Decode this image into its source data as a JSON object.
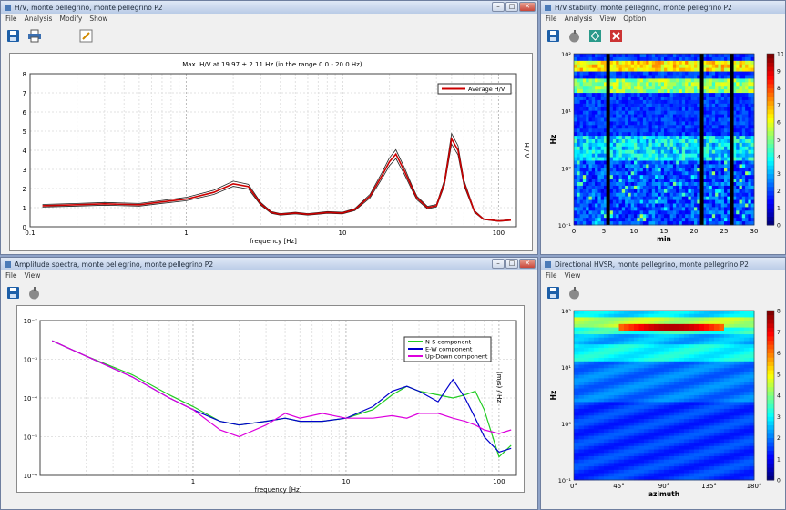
{
  "colors": {
    "red": "#cc0000",
    "green": "#22cc22",
    "blue": "#0000cc",
    "magenta": "#dd00dd",
    "titlebar": "#c9d7ee"
  },
  "hv_window": {
    "title": "H/V, monte pellegrino, monte pellegrino P2",
    "menu": [
      "File",
      "Analysis",
      "Modify",
      "Show"
    ],
    "toolbar_icons": [
      "save-icon",
      "print-icon",
      "edit-icon"
    ],
    "chart_data": {
      "type": "line",
      "title": "Max. H/V at 19.97 ± 2.11 Hz (in the range 0.0 - 20.0 Hz).",
      "xlabel": "frequency [Hz]",
      "ylabel": "H / V",
      "x_scale": "log",
      "xlim": [
        0.1,
        130
      ],
      "ylim": [
        0,
        8
      ],
      "y_ticks": [
        "0",
        "1",
        "2",
        "3",
        "4",
        "5",
        "6",
        "7",
        "8"
      ],
      "x_ticks": [
        "0.1",
        "1",
        "10",
        "100"
      ],
      "legend": "top-right",
      "series": [
        {
          "name": "Average H/V",
          "x": [
            0.12,
            0.2,
            0.3,
            0.5,
            0.7,
            1.0,
            1.5,
            2.0,
            2.5,
            3.0,
            3.5,
            4.0,
            5.0,
            6.0,
            7.0,
            8.0,
            10,
            12,
            15,
            18,
            20,
            22,
            25,
            28,
            30,
            35,
            40,
            45,
            50,
            55,
            60,
            70,
            80,
            100,
            120
          ],
          "y": [
            1.1,
            1.15,
            1.2,
            1.15,
            1.3,
            1.45,
            1.8,
            2.25,
            2.1,
            1.2,
            0.75,
            0.65,
            0.72,
            0.65,
            0.7,
            0.75,
            0.72,
            0.9,
            1.6,
            2.7,
            3.4,
            3.8,
            2.9,
            2.0,
            1.5,
            1.0,
            1.1,
            2.3,
            4.6,
            4.0,
            2.3,
            0.8,
            0.4,
            0.3,
            0.35
          ]
        }
      ]
    }
  },
  "stability_window": {
    "title": "H/V stability, monte pellegrino, monte pellegrino P2",
    "menu": [
      "File",
      "Analysis",
      "View",
      "Option"
    ],
    "toolbar_icons": [
      "save-icon",
      "apple-icon",
      "arrows-icon",
      "close-red-icon"
    ],
    "chart_data": {
      "type": "heatmap",
      "xlabel": "min",
      "ylabel": "Hz",
      "x_ticks": [
        "0",
        "5",
        "10",
        "15",
        "20",
        "25",
        "30"
      ],
      "y_ticks": [
        "10⁻¹",
        "10⁰",
        "10¹",
        "10²"
      ],
      "colorbar_ticks": [
        "0",
        "1",
        "2",
        "3",
        "4",
        "5",
        "6",
        "7",
        "8",
        "9",
        "10"
      ],
      "bright_bands_hz": [
        50,
        20
      ]
    }
  },
  "spectra_window": {
    "title": "Amplitude spectra, monte pellegrino, monte pellegrino P2",
    "menu": [
      "File",
      "View"
    ],
    "toolbar_icons": [
      "save-icon",
      "apple-icon"
    ],
    "chart_data": {
      "type": "line",
      "xlabel": "frequency [Hz]",
      "ylabel": "(m/s) / Hz",
      "x_scale": "log",
      "y_scale": "log",
      "xlim": [
        0.1,
        130
      ],
      "ylim": [
        1e-06,
        0.01
      ],
      "x_ticks": [
        "1",
        "10",
        "100"
      ],
      "y_ticks": [
        "10⁻²",
        "10⁻³",
        "10⁻⁴",
        "10⁻⁵",
        "10⁻⁶"
      ],
      "legend": "top-right",
      "series": [
        {
          "name": "N-S component",
          "x": [
            0.12,
            0.2,
            0.4,
            0.7,
            1.0,
            1.5,
            2.0,
            3.0,
            4.0,
            5.0,
            7.0,
            10,
            15,
            20,
            25,
            30,
            40,
            50,
            60,
            70,
            80,
            100,
            120
          ],
          "y": [
            0.003,
            0.0012,
            0.0004,
            0.00012,
            6e-05,
            2.5e-05,
            2e-05,
            2.5e-05,
            3e-05,
            2.5e-05,
            2.5e-05,
            3e-05,
            5e-05,
            0.00012,
            0.0002,
            0.00015,
            0.00012,
            0.0001,
            0.00012,
            0.00015,
            5e-05,
            3e-06,
            6e-06
          ]
        },
        {
          "name": "E-W component",
          "x": [
            0.12,
            0.2,
            0.4,
            0.7,
            1.0,
            1.5,
            2.0,
            3.0,
            4.0,
            5.0,
            7.0,
            10,
            15,
            20,
            25,
            30,
            40,
            50,
            60,
            70,
            80,
            100,
            120
          ],
          "y": [
            0.003,
            0.0012,
            0.00035,
            0.0001,
            5e-05,
            2.5e-05,
            2e-05,
            2.5e-05,
            3e-05,
            2.5e-05,
            2.5e-05,
            3e-05,
            6e-05,
            0.00015,
            0.0002,
            0.00015,
            8e-05,
            0.0003,
            0.0001,
            3e-05,
            1e-05,
            4e-06,
            5e-06
          ]
        },
        {
          "name": "Up-Down component",
          "x": [
            0.12,
            0.2,
            0.4,
            0.7,
            1.0,
            1.5,
            2.0,
            3.0,
            4.0,
            5.0,
            7.0,
            10,
            15,
            20,
            25,
            30,
            40,
            50,
            60,
            70,
            80,
            100,
            120
          ],
          "y": [
            0.003,
            0.0012,
            0.00035,
            0.0001,
            5e-05,
            1.5e-05,
            1e-05,
            2e-05,
            4e-05,
            3e-05,
            4e-05,
            3e-05,
            3e-05,
            3.5e-05,
            3e-05,
            4e-05,
            4e-05,
            3e-05,
            2.5e-05,
            2e-05,
            1.5e-05,
            1.2e-05,
            1.5e-05
          ]
        }
      ]
    }
  },
  "directional_window": {
    "title": "Directional HVSR, monte pellegrino, monte pellegrino P2",
    "menu": [
      "File",
      "View"
    ],
    "toolbar_icons": [
      "save-icon",
      "apple-icon"
    ],
    "chart_data": {
      "type": "heatmap",
      "xlabel": "azimuth",
      "ylabel": "Hz",
      "x_ticks": [
        "0°",
        "45°",
        "90°",
        "135°",
        "180°"
      ],
      "y_ticks": [
        "10⁻¹",
        "10⁰",
        "10¹",
        "10²"
      ],
      "colorbar_ticks": [
        "0",
        "1",
        "2",
        "3",
        "4",
        "5",
        "6",
        "7",
        "8"
      ]
    }
  }
}
